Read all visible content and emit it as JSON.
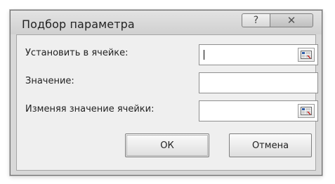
{
  "window": {
    "title": "Подбор параметра",
    "title_buttons": [
      {
        "name": "help",
        "icon": "help-icon"
      },
      {
        "name": "close",
        "icon": "close-icon"
      }
    ]
  },
  "form": {
    "rows": [
      {
        "label": "Установить в ячейке:",
        "input_value": "",
        "has_picker": true,
        "focused": true
      },
      {
        "label": "Значение:",
        "input_value": "",
        "has_picker": false,
        "focused": false
      },
      {
        "label": "Изменяя значение ячейки:",
        "input_value": "",
        "has_picker": true,
        "focused": false
      }
    ]
  },
  "buttons": {
    "ok": "ОК",
    "cancel": "Отмена"
  },
  "icons": {
    "help": "?",
    "close": "✕"
  }
}
